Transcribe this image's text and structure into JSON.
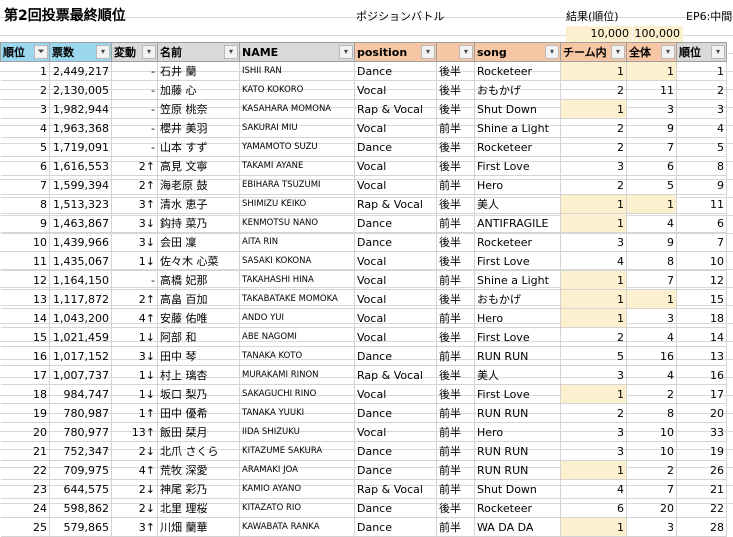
{
  "title": "第2回投票最終順位",
  "position_battle_label": "ポジションバトル",
  "result_label": "結果(順位)",
  "ep6_label": "EP6:中間",
  "sub_a": "10,000",
  "sub_b": "100,000",
  "headers": {
    "rank": "順位",
    "votes": "票数",
    "change": "変動",
    "name": "名前",
    "romaji": "NAME",
    "position": "position",
    "half": "",
    "song": "song",
    "team_rank": "チーム内",
    "overall_rank": "全体",
    "ep6_rank": "順位"
  },
  "rows": [
    {
      "rank": "1",
      "votes": "2,449,217",
      "change": "-",
      "name": "石井 蘭",
      "romaji": "ISHII RAN",
      "position": "Dance",
      "half": "後半",
      "song": "Rocketeer",
      "team": "1",
      "overall": "1",
      "ep6": "1",
      "hl_team": true,
      "hl_overall": true
    },
    {
      "rank": "2",
      "votes": "2,130,005",
      "change": "-",
      "name": "加藤 心",
      "romaji": "KATO KOKORO",
      "position": "Vocal",
      "half": "後半",
      "song": "おもかげ",
      "team": "2",
      "overall": "11",
      "ep6": "2",
      "hl_team": false,
      "hl_overall": false
    },
    {
      "rank": "3",
      "votes": "1,982,944",
      "change": "-",
      "name": "笠原 桃奈",
      "romaji": "KASAHARA MOMONA",
      "position": "Rap & Vocal",
      "half": "後半",
      "song": "Shut Down",
      "team": "1",
      "overall": "3",
      "ep6": "3",
      "hl_team": true,
      "hl_overall": false
    },
    {
      "rank": "4",
      "votes": "1,963,368",
      "change": "-",
      "name": "櫻井 美羽",
      "romaji": "SAKURAI MIU",
      "position": "Vocal",
      "half": "前半",
      "song": "Shine a Light",
      "team": "2",
      "overall": "9",
      "ep6": "4",
      "hl_team": false,
      "hl_overall": false
    },
    {
      "rank": "5",
      "votes": "1,719,091",
      "change": "-",
      "name": "山本 すず",
      "romaji": "YAMAMOTO SUZU",
      "position": "Dance",
      "half": "後半",
      "song": "Rocketeer",
      "team": "2",
      "overall": "7",
      "ep6": "5",
      "hl_team": false,
      "hl_overall": false
    },
    {
      "rank": "6",
      "votes": "1,616,553",
      "change": "2↑",
      "name": "高見 文寧",
      "romaji": "TAKAMI AYANE",
      "position": "Vocal",
      "half": "後半",
      "song": "First Love",
      "team": "3",
      "overall": "6",
      "ep6": "8",
      "hl_team": false,
      "hl_overall": false
    },
    {
      "rank": "7",
      "votes": "1,599,394",
      "change": "2↑",
      "name": "海老原 鼓",
      "romaji": "EBIHARA TSUZUMI",
      "position": "Vocal",
      "half": "前半",
      "song": "Hero",
      "team": "2",
      "overall": "5",
      "ep6": "9",
      "hl_team": false,
      "hl_overall": false
    },
    {
      "rank": "8",
      "votes": "1,513,323",
      "change": "3↑",
      "name": "清水 恵子",
      "romaji": "SHIMIZU KEIKO",
      "position": "Rap & Vocal",
      "half": "後半",
      "song": "美人",
      "team": "1",
      "overall": "1",
      "ep6": "11",
      "hl_team": true,
      "hl_overall": true
    },
    {
      "rank": "9",
      "votes": "1,463,867",
      "change": "3↓",
      "name": "鈎持 菜乃",
      "romaji": "KENMOTSU NANO",
      "position": "Dance",
      "half": "前半",
      "song": "ANTIFRAGILE",
      "team": "1",
      "overall": "4",
      "ep6": "6",
      "hl_team": true,
      "hl_overall": false
    },
    {
      "rank": "10",
      "votes": "1,439,966",
      "change": "3↓",
      "name": "会田 凜",
      "romaji": "AITA RIN",
      "position": "Dance",
      "half": "後半",
      "song": "Rocketeer",
      "team": "3",
      "overall": "9",
      "ep6": "7",
      "hl_team": false,
      "hl_overall": false
    },
    {
      "rank": "11",
      "votes": "1,435,067",
      "change": "1↓",
      "name": "佐々木 心菜",
      "romaji": "SASAKI KOKONA",
      "position": "Vocal",
      "half": "後半",
      "song": "First Love",
      "team": "4",
      "overall": "8",
      "ep6": "10",
      "hl_team": false,
      "hl_overall": false
    },
    {
      "rank": "12",
      "votes": "1,164,150",
      "change": "-",
      "name": "高橋 妃那",
      "romaji": "TAKAHASHI HINA",
      "position": "Vocal",
      "half": "前半",
      "song": "Shine a Light",
      "team": "1",
      "overall": "7",
      "ep6": "12",
      "hl_team": true,
      "hl_overall": false
    },
    {
      "rank": "13",
      "votes": "1,117,872",
      "change": "2↑",
      "name": "高畠 百加",
      "romaji": "TAKABATAKE MOMOKA",
      "position": "Vocal",
      "half": "後半",
      "song": "おもかげ",
      "team": "1",
      "overall": "1",
      "ep6": "15",
      "hl_team": true,
      "hl_overall": true
    },
    {
      "rank": "14",
      "votes": "1,043,200",
      "change": "4↑",
      "name": "安藤 佑唯",
      "romaji": "ANDO YUI",
      "position": "Vocal",
      "half": "前半",
      "song": "Hero",
      "team": "1",
      "overall": "3",
      "ep6": "18",
      "hl_team": true,
      "hl_overall": false
    },
    {
      "rank": "15",
      "votes": "1,021,459",
      "change": "1↓",
      "name": "阿部 和",
      "romaji": "ABE NAGOMI",
      "position": "Vocal",
      "half": "後半",
      "song": "First Love",
      "team": "2",
      "overall": "4",
      "ep6": "14",
      "hl_team": false,
      "hl_overall": false
    },
    {
      "rank": "16",
      "votes": "1,017,152",
      "change": "3↓",
      "name": "田中 琴",
      "romaji": "TANAKA KOTO",
      "position": "Dance",
      "half": "前半",
      "song": "RUN RUN",
      "team": "5",
      "overall": "16",
      "ep6": "13",
      "hl_team": false,
      "hl_overall": false
    },
    {
      "rank": "17",
      "votes": "1,007,737",
      "change": "1↓",
      "name": "村上 璃杏",
      "romaji": "MURAKAMI RINON",
      "position": "Rap & Vocal",
      "half": "後半",
      "song": "美人",
      "team": "3",
      "overall": "4",
      "ep6": "16",
      "hl_team": false,
      "hl_overall": false
    },
    {
      "rank": "18",
      "votes": "984,747",
      "change": "1↓",
      "name": "坂口 梨乃",
      "romaji": "SAKAGUCHI RINO",
      "position": "Vocal",
      "half": "後半",
      "song": "First Love",
      "team": "1",
      "overall": "2",
      "ep6": "17",
      "hl_team": true,
      "hl_overall": false
    },
    {
      "rank": "19",
      "votes": "780,987",
      "change": "1↑",
      "name": "田中 優希",
      "romaji": "TANAKA YUUKI",
      "position": "Dance",
      "half": "前半",
      "song": "RUN RUN",
      "team": "2",
      "overall": "8",
      "ep6": "20",
      "hl_team": false,
      "hl_overall": false
    },
    {
      "rank": "20",
      "votes": "780,977",
      "change": "13↑",
      "name": "飯田 栞月",
      "romaji": "IIDA SHIZUKU",
      "position": "Vocal",
      "half": "前半",
      "song": "Hero",
      "team": "3",
      "overall": "10",
      "ep6": "33",
      "hl_team": false,
      "hl_overall": false
    },
    {
      "rank": "21",
      "votes": "752,347",
      "change": "2↓",
      "name": "北爪 さくら",
      "romaji": "KITAZUME SAKURA",
      "position": "Dance",
      "half": "前半",
      "song": "RUN RUN",
      "team": "3",
      "overall": "10",
      "ep6": "19",
      "hl_team": false,
      "hl_overall": false
    },
    {
      "rank": "22",
      "votes": "709,975",
      "change": "4↑",
      "name": "荒牧 深愛",
      "romaji": "ARAMAKI JOA",
      "position": "Dance",
      "half": "前半",
      "song": "RUN RUN",
      "team": "1",
      "overall": "2",
      "ep6": "26",
      "hl_team": true,
      "hl_overall": false
    },
    {
      "rank": "23",
      "votes": "644,575",
      "change": "2↓",
      "name": "神尾 彩乃",
      "romaji": "KAMIO AYANO",
      "position": "Rap & Vocal",
      "half": "前半",
      "song": "Shut Down",
      "team": "4",
      "overall": "7",
      "ep6": "21",
      "hl_team": false,
      "hl_overall": false
    },
    {
      "rank": "24",
      "votes": "598,862",
      "change": "2↓",
      "name": "北里 理桜",
      "romaji": "KITAZATO RIO",
      "position": "Dance",
      "half": "後半",
      "song": "Rocketeer",
      "team": "6",
      "overall": "20",
      "ep6": "22",
      "hl_team": false,
      "hl_overall": false
    },
    {
      "rank": "25",
      "votes": "579,865",
      "change": "3↑",
      "name": "川畑 蘭華",
      "romaji": "KAWABATA RANKA",
      "position": "Dance",
      "half": "前半",
      "song": "WA DA DA",
      "team": "1",
      "overall": "3",
      "ep6": "28",
      "hl_team": true,
      "hl_overall": false
    }
  ],
  "colors": {
    "header_blue": "#9bd7ee",
    "header_orange": "#f7c6a4",
    "header_gray": "#d9d9d9",
    "highlight": "#fdf0cf"
  }
}
